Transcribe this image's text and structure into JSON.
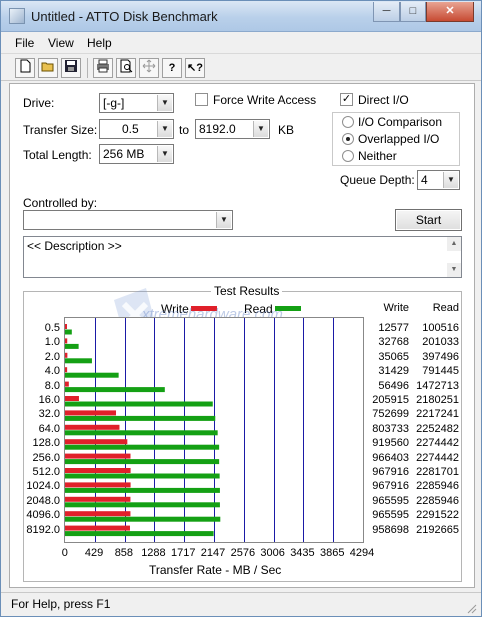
{
  "window": {
    "title": "Untitled - ATTO Disk Benchmark",
    "buttons": {
      "minimize": "─",
      "maximize": "□",
      "close": "✕"
    }
  },
  "menu": [
    "File",
    "View",
    "Help"
  ],
  "toolbar_icons": [
    "new-file-icon",
    "open-folder-icon",
    "save-icon",
    "print-icon",
    "print-preview-icon",
    "move-icon",
    "help-icon",
    "context-help-icon"
  ],
  "form": {
    "drive_label": "Drive:",
    "drive_value": "[-g-]",
    "transfer_size_label": "Transfer Size:",
    "transfer_from": "0.5",
    "to_label": "to",
    "transfer_to": "8192.0",
    "kb_label": "KB",
    "total_length_label": "Total Length:",
    "total_length": "256 MB",
    "force_write_label": "Force Write Access",
    "force_write_checked": false,
    "direct_io_label": "Direct I/O",
    "direct_io_checked": true,
    "io_comparison_label": "I/O Comparison",
    "overlapped_io_label": "Overlapped I/O",
    "neither_label": "Neither",
    "selected_mode": "Overlapped I/O",
    "queue_depth_label": "Queue Depth:",
    "queue_depth": "4",
    "controlled_by_label": "Controlled by:",
    "controlled_by_value": "",
    "start_label": "Start",
    "description_text": "<< Description >>"
  },
  "results": {
    "group_title": "Test Results",
    "legend_write": "Write",
    "legend_read": "Read",
    "write_color": "#e0202a",
    "read_color": "#14a014",
    "grid_color": "#1a1aa6",
    "col_write_header": "Write",
    "col_read_header": "Read",
    "watermark": "xtremehardware.com",
    "xlabel": "Transfer Rate - MB / Sec"
  },
  "chart_data": {
    "type": "bar",
    "orientation": "horizontal",
    "categories": [
      "0.5",
      "1.0",
      "2.0",
      "4.0",
      "8.0",
      "16.0",
      "32.0",
      "64.0",
      "128.0",
      "256.0",
      "512.0",
      "1024.0",
      "2048.0",
      "4096.0",
      "8192.0"
    ],
    "series": [
      {
        "name": "Write",
        "values": [
          12577,
          32768,
          35065,
          31429,
          56496,
          205915,
          752699,
          803733,
          919560,
          966403,
          967916,
          967916,
          965595,
          965595,
          958698
        ]
      },
      {
        "name": "Read",
        "values": [
          100516,
          201033,
          397496,
          791445,
          1472713,
          2180251,
          2217241,
          2252482,
          2274442,
          2274442,
          2281701,
          2285946,
          2285946,
          2291522,
          2192665
        ]
      }
    ],
    "x_ticks": [
      "0",
      "429",
      "858",
      "1288",
      "1717",
      "2147",
      "2576",
      "3006",
      "3435",
      "3865",
      "4294"
    ],
    "xlim": [
      0,
      4294
    ],
    "xlabel": "Transfer Rate - MB / Sec",
    "grid": true,
    "legend": "top"
  },
  "status": {
    "text": "For Help, press F1"
  }
}
